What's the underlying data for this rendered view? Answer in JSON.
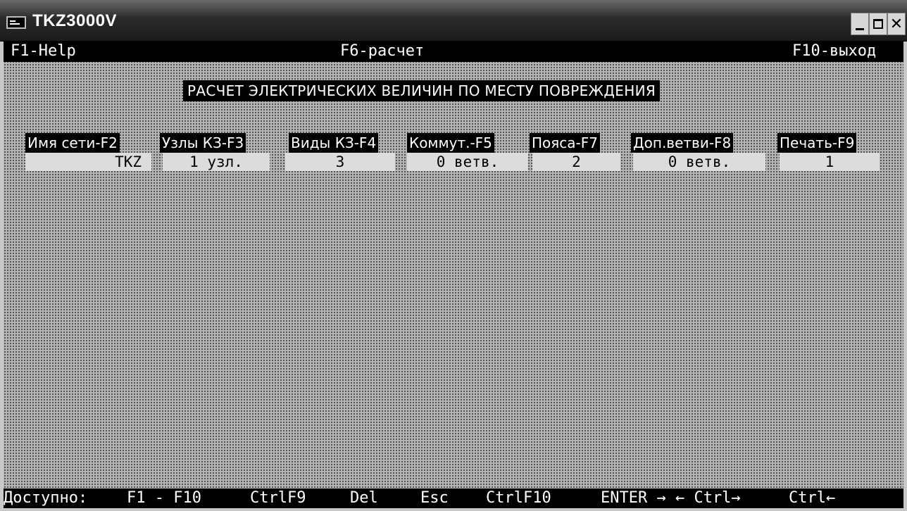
{
  "window": {
    "title": "TKZ3000V",
    "icon": "console-app-icon",
    "controls": {
      "minimize": "minimize-icon",
      "maximize": "maximize-icon",
      "close": "✕"
    }
  },
  "function_bar": {
    "help": "F1-Help",
    "calc": "F6-расчет",
    "exit": "F10-выход"
  },
  "headline": "РАСЧЕТ ЭЛЕКТРИЧЕСКИХ ВЕЛИЧИН ПО МЕСТУ ПОВРЕЖДЕНИЯ",
  "columns": [
    {
      "label": "Имя сети-F2",
      "value": "TKZ"
    },
    {
      "label": "Узлы КЗ-F3",
      "value": "1 узл."
    },
    {
      "label": "Виды КЗ-F4",
      "value": "3"
    },
    {
      "label": "Коммут.-F5",
      "value": "0 ветв."
    },
    {
      "label": "Пояса-F7",
      "value": "2"
    },
    {
      "label": "Доп.ветви-F8",
      "value": "0 ветв."
    },
    {
      "label": "Печать-F9",
      "value": "1"
    }
  ],
  "status_bar": {
    "available": "Доступно:",
    "f1_f10": "F1 - F10",
    "ctrl_f9": "CtrlF9",
    "del": "Del",
    "esc": "Esc",
    "ctrl_f10": "CtrlF10",
    "enter": "ENTER → ← Ctrl→",
    "ctrl_left": "Ctrl←"
  },
  "colors": {
    "background": "#b4b4b4",
    "bar": "#000000",
    "text": "#ffffff",
    "field": "#dcdcdc"
  }
}
